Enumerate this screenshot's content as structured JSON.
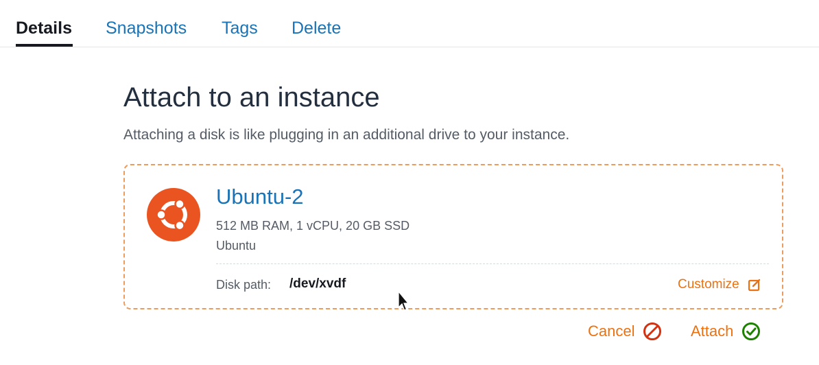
{
  "tabs": [
    {
      "label": "Details",
      "active": true
    },
    {
      "label": "Snapshots",
      "active": false
    },
    {
      "label": "Tags",
      "active": false
    },
    {
      "label": "Delete",
      "active": false
    }
  ],
  "attach_panel": {
    "heading": "Attach to an instance",
    "description": "Attaching a disk is like plugging in an additional drive to your instance."
  },
  "instance": {
    "name": "Ubuntu-2",
    "specs": "512 MB RAM, 1 vCPU, 20 GB SSD",
    "os": "Ubuntu",
    "icon": "ubuntu-logo-icon",
    "disk_path_label": "Disk path:",
    "disk_path_value": "/dev/xvdf",
    "customize_label": "Customize"
  },
  "actions": {
    "cancel_label": "Cancel",
    "attach_label": "Attach"
  },
  "colors": {
    "link_blue": "#1a73b6",
    "accent_orange": "#ec7211",
    "ubuntu_orange": "#e95420",
    "cancel_red": "#d13212",
    "attach_green": "#1d8102",
    "card_border": "#ec9b5d"
  }
}
